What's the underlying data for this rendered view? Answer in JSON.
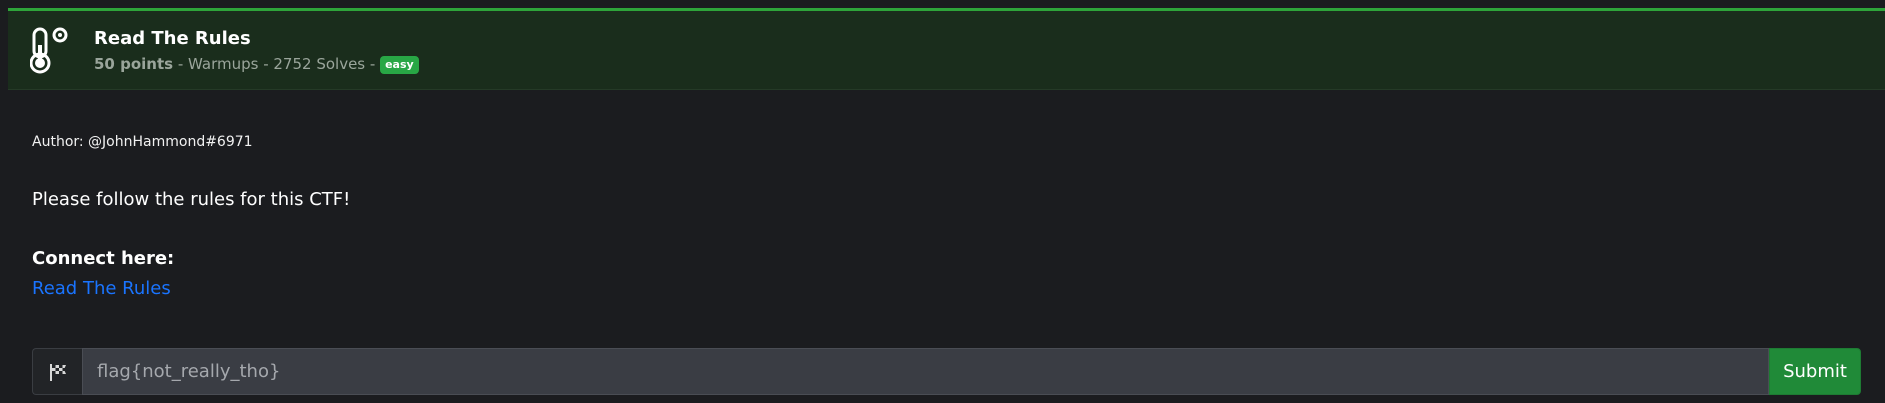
{
  "challenge": {
    "title": "Read The Rules",
    "points": "50 points",
    "category_text": " - Warmups - 2752 Solves - ",
    "difficulty": "easy",
    "author": "Author: @JohnHammond#6971",
    "description": "Please follow the rules for this CTF!",
    "connect_label": "Connect here:",
    "connect_link_text": "Read The Rules"
  },
  "flag_form": {
    "placeholder": "flag{not_really_tho}",
    "submit_label": "Submit"
  },
  "icons": {
    "header": "thermometer-icon",
    "flag_addon": "checkered-flag-icon"
  },
  "colors": {
    "accent_green": "#2ea43a",
    "header_bg": "#1a2d1c",
    "page_bg": "#1b1c1f",
    "badge_bg": "#28a745",
    "link": "#1a74ff",
    "submit_bg": "#208a38"
  }
}
